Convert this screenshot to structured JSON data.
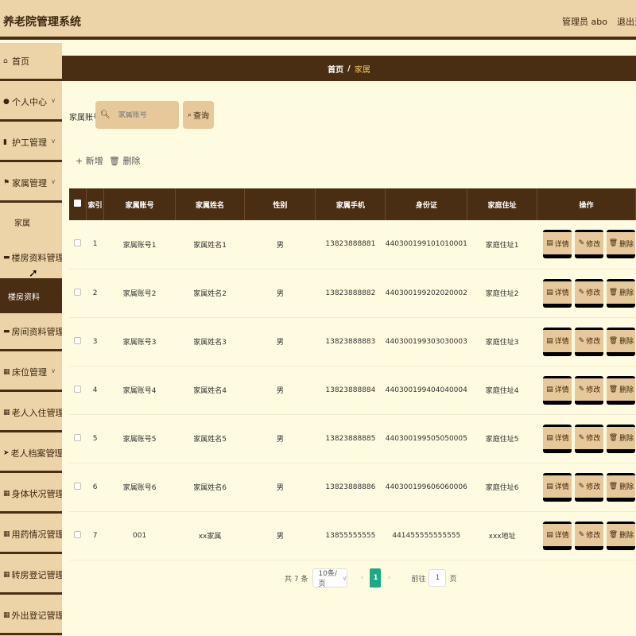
{
  "header": {
    "title": "养老院管理系统",
    "admin": "管理员 abo",
    "logout": "退出登录"
  },
  "sidebar": {
    "items": [
      {
        "label": "首页",
        "icon": "home-icon",
        "glyph": "⌂"
      },
      {
        "label": "个人中心",
        "icon": "user-icon",
        "glyph": "●"
      },
      {
        "label": "护工管理",
        "icon": "bar-chart-icon",
        "glyph": "▮"
      },
      {
        "label": "家属管理",
        "icon": "flag-icon",
        "glyph": "⚑"
      },
      {
        "label": "楼房资料管理",
        "icon": "message-icon",
        "glyph": "▬"
      },
      {
        "label": "房间资料管理",
        "icon": "message-icon",
        "glyph": "▬"
      },
      {
        "label": "床位管理",
        "icon": "grid-icon",
        "glyph": "▦"
      },
      {
        "label": "老人入住管理",
        "icon": "grid-icon",
        "glyph": "▦"
      },
      {
        "label": "老人档案管理",
        "icon": "send-icon",
        "glyph": "➤"
      },
      {
        "label": "身体状况管理",
        "icon": "grid-icon",
        "glyph": "▦"
      },
      {
        "label": "用药情况管理",
        "icon": "grid-icon",
        "glyph": "▦"
      },
      {
        "label": "转房登记管理",
        "icon": "grid-icon",
        "glyph": "▦"
      },
      {
        "label": "外出登记管理",
        "icon": "grid-icon",
        "glyph": "▦"
      }
    ],
    "sub_family": "家属",
    "sub_building": "楼房资料"
  },
  "breadcrumb": {
    "home": "首页",
    "sep": "/",
    "current": "家属"
  },
  "search": {
    "label": "家属账号",
    "placeholder": "家属账号",
    "button": "查询"
  },
  "actions": {
    "add": "新增",
    "delete": "删除"
  },
  "table": {
    "columns": [
      "索引",
      "家属账号",
      "家属姓名",
      "性别",
      "家属手机",
      "身份证",
      "家庭住址",
      "操作"
    ],
    "rows": [
      {
        "index": "1",
        "account": "家属账号1",
        "name": "家属姓名1",
        "gender": "男",
        "phone": "13823888881",
        "id_card": "440300199101010001",
        "address": "家庭住址1"
      },
      {
        "index": "2",
        "account": "家属账号2",
        "name": "家属姓名2",
        "gender": "男",
        "phone": "13823888882",
        "id_card": "440300199202020002",
        "address": "家庭住址2"
      },
      {
        "index": "3",
        "account": "家属账号3",
        "name": "家属姓名3",
        "gender": "男",
        "phone": "13823888883",
        "id_card": "440300199303030003",
        "address": "家庭住址3"
      },
      {
        "index": "4",
        "account": "家属账号4",
        "name": "家属姓名4",
        "gender": "男",
        "phone": "13823888884",
        "id_card": "440300199404040004",
        "address": "家庭住址4"
      },
      {
        "index": "5",
        "account": "家属账号5",
        "name": "家属姓名5",
        "gender": "男",
        "phone": "13823888885",
        "id_card": "440300199505050005",
        "address": "家庭住址5"
      },
      {
        "index": "6",
        "account": "家属账号6",
        "name": "家属姓名6",
        "gender": "男",
        "phone": "13823888886",
        "id_card": "440300199606060006",
        "address": "家庭住址6"
      },
      {
        "index": "7",
        "account": "001",
        "name": "xx家属",
        "gender": "男",
        "phone": "13855555555",
        "id_card": "441455555555555",
        "address": "xxx地址"
      }
    ],
    "op_detail": "详情",
    "op_edit": "修改",
    "op_delete": "删除"
  },
  "pagination": {
    "total": "共 7 条",
    "page_size": "10条/页",
    "page": "1",
    "goto_prefix": "前往",
    "goto_value": "1",
    "goto_suffix": "页"
  },
  "colors": {
    "brand_dark": "#4a2e14",
    "sidebar_bg": "#ecd4a8",
    "content_bg": "#fffbe0",
    "accent_gold": "#f6c65a",
    "pager_active": "#1aa982"
  }
}
